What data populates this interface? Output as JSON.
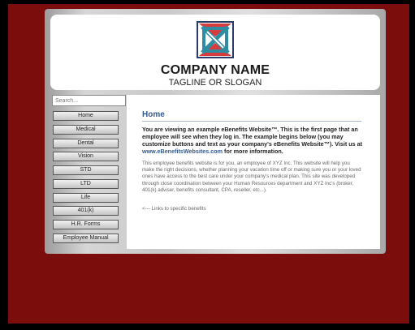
{
  "header": {
    "company_name": "COMPANY NAME",
    "tagline": "TAGLINE OR SLOGAN",
    "logo_icon": "company-logo-mark"
  },
  "search": {
    "placeholder": "Search..."
  },
  "nav": {
    "items": [
      {
        "label": "Home"
      },
      {
        "label": "Medical"
      },
      {
        "label": "Dental"
      },
      {
        "label": "Vision"
      },
      {
        "label": "STD"
      },
      {
        "label": "LTD"
      },
      {
        "label": "Life"
      },
      {
        "label": "401(k)"
      },
      {
        "label": "H.R. Forms"
      },
      {
        "label": "Employee Manual"
      }
    ]
  },
  "main": {
    "title": "Home",
    "intro_part1": "You are viewing an example eBenefits Website™.  This is the first page that an employee will see when they log in.  The example begins below (you may customize buttons and text as your company's eBenefits Website™).  Visit us at ",
    "intro_link": "www.eBenefitsWebsites.com",
    "intro_part2": " for more information.",
    "body": "This employee benefits website is for you, an employee of XYZ Inc.  This website will help you make the right decisions, whether planning your vacation time off or making sure you or your loved ones have access to the best care under your company's medical plan.  This site was developed through close coordination between your Human Resources department and XYZ Inc's (broker, 401(k) adviser, benefits consultant, CPA, reseller, etc...).",
    "links_note": "<--- Links to specific benefits"
  },
  "colors": {
    "frame": "#7c0d0d",
    "title": "#335a8e",
    "logo_red": "#d63c3c",
    "logo_teal": "#2f8da3",
    "logo_navy": "#2b3a67"
  }
}
